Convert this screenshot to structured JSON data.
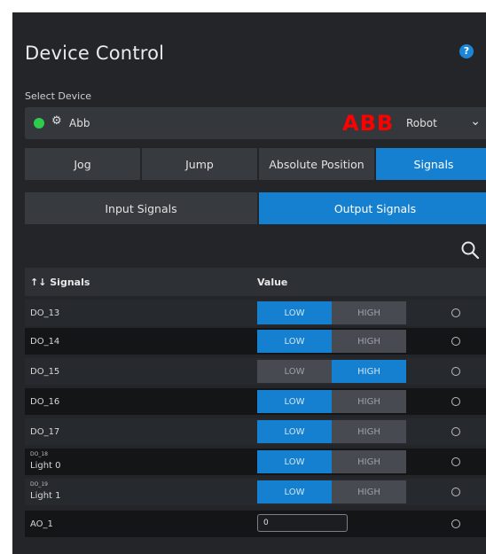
{
  "header": {
    "title": "Device Control",
    "help_label": "?"
  },
  "device": {
    "label": "Select Device",
    "name": "Abb",
    "brand_logo": "ABB",
    "type": "Robot",
    "status_color": "#2ecc4b"
  },
  "tabs": [
    {
      "label": "Jog",
      "active": false
    },
    {
      "label": "Jump",
      "active": false
    },
    {
      "label": "Absolute Position",
      "active": false
    },
    {
      "label": "Signals",
      "active": true
    }
  ],
  "subtabs": [
    {
      "label": "Input Signals",
      "active": false
    },
    {
      "label": "Output Signals",
      "active": true
    }
  ],
  "table": {
    "col_signals": "↑↓ Signals",
    "col_value": "Value",
    "rows": [
      {
        "name": "DO_13",
        "low": "LOW",
        "high": "HIGH",
        "state": "LOW"
      },
      {
        "name": "DO_14",
        "low": "LOW",
        "high": "HIGH",
        "state": "LOW"
      },
      {
        "name": "DO_15",
        "low": "LOW",
        "high": "HIGH",
        "state": "HIGH"
      },
      {
        "name": "DO_16",
        "low": "LOW",
        "high": "HIGH",
        "state": "LOW"
      },
      {
        "name": "DO_17",
        "low": "LOW",
        "high": "HIGH",
        "state": "LOW"
      },
      {
        "name": "DO_18",
        "alias": "Light 0",
        "low": "LOW",
        "high": "HIGH",
        "state": "LOW"
      },
      {
        "name": "DO_19",
        "alias": "Light 1",
        "low": "LOW",
        "high": "HIGH",
        "state": "LOW"
      },
      {
        "name": "AO_1",
        "value": "0"
      }
    ]
  },
  "colors": {
    "accent": "#1680d0",
    "panel": "#232529",
    "brand": "#ff0000"
  }
}
